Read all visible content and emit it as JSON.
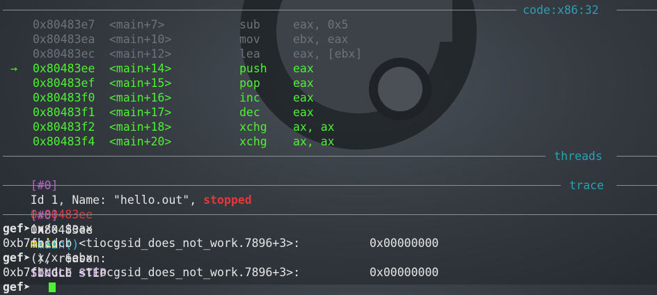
{
  "sections": {
    "code_label": "code:x86:32",
    "threads_label": "threads",
    "trace_label": "trace"
  },
  "disasm": {
    "current_marker": "→",
    "rows": [
      {
        "addr": "0x80483e7",
        "sym": "<main+7>",
        "mnem": "sub",
        "ops": "eax, 0x5",
        "state": "past"
      },
      {
        "addr": "0x80483ea",
        "sym": "<main+10>",
        "mnem": "mov",
        "ops": "ebx, eax",
        "state": "past"
      },
      {
        "addr": "0x80483ec",
        "sym": "<main+12>",
        "mnem": "lea",
        "ops": "eax, [ebx]",
        "state": "past"
      },
      {
        "addr": "0x80483ee",
        "sym": "<main+14>",
        "mnem": "push",
        "ops": "eax",
        "state": "current"
      },
      {
        "addr": "0x80483ef",
        "sym": "<main+15>",
        "mnem": "pop",
        "ops": "eax",
        "state": "next"
      },
      {
        "addr": "0x80483f0",
        "sym": "<main+16>",
        "mnem": "inc",
        "ops": "eax",
        "state": "next"
      },
      {
        "addr": "0x80483f1",
        "sym": "<main+17>",
        "mnem": "dec",
        "ops": "eax",
        "state": "next"
      },
      {
        "addr": "0x80483f2",
        "sym": "<main+18>",
        "mnem": "xchg",
        "ops": "ax, ax",
        "state": "next"
      },
      {
        "addr": "0x80483f4",
        "sym": "<main+20>",
        "mnem": "xchg",
        "ops": "ax, ax",
        "state": "next"
      }
    ]
  },
  "thread": {
    "index": "[#0]",
    "id_text": "Id 1, Name: ",
    "name": "\"hello.out\"",
    "sep": ", ",
    "status": "stopped",
    "addr": "0x80483ee",
    "in_text": "in",
    "func": "main",
    "paren_text": "(), reason:",
    "reason": "SINGLE STEP"
  },
  "trace": {
    "index": "[#0]",
    "addr": "0x80483ee",
    "arrow": "→",
    "func": "main()"
  },
  "console": [
    {
      "prompt": "gef➤",
      "cmd": "x/x $eax"
    },
    {
      "output": "0xb7fbcdcb <tiocgsid_does_not_work.7896+3>:",
      "value": "0x00000000"
    },
    {
      "prompt": "gef➤",
      "cmd": "x/x $ebx"
    },
    {
      "output": "0xb7fbcdcb <tiocgsid_does_not_work.7896+3>:",
      "value": "0x00000000"
    },
    {
      "prompt": "gef➤",
      "cmd": ""
    }
  ]
}
